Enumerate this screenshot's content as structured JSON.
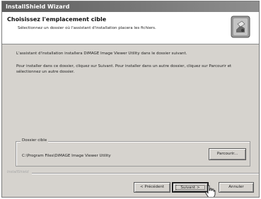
{
  "window": {
    "title": "InstallShield Wizard"
  },
  "header": {
    "title": "Choisissez l'emplacement cible",
    "description": "Sélectionnez un dossier où l'assistant d'installation placera les fichiers.",
    "icon": "installer-box-icon"
  },
  "body": {
    "paragraph1": "L'assistant d'installation installera DiMAGE Image Viewer Utility dans le dossier suivant.",
    "paragraph2": "Pour installer dans ce dossier, cliquez sur Suivant. Pour installer dans un autre dossier, cliquez sur Parcourir et sélectionnez un autre dossier."
  },
  "destination": {
    "group_label": "Dossier cible",
    "path": "C:\\Program Files\\DiMAGE Image Viewer Utility",
    "browse_label": "Parcourir..."
  },
  "footer": {
    "brand": "InstallShield",
    "back_label": "< Précédent",
    "next_label": "Suivant >",
    "cancel_label": "Annuler"
  },
  "colors": {
    "dialog_bg": "#d6d3ce",
    "title_bar": "#6e6e6e",
    "header_bg": "#ffffff"
  }
}
